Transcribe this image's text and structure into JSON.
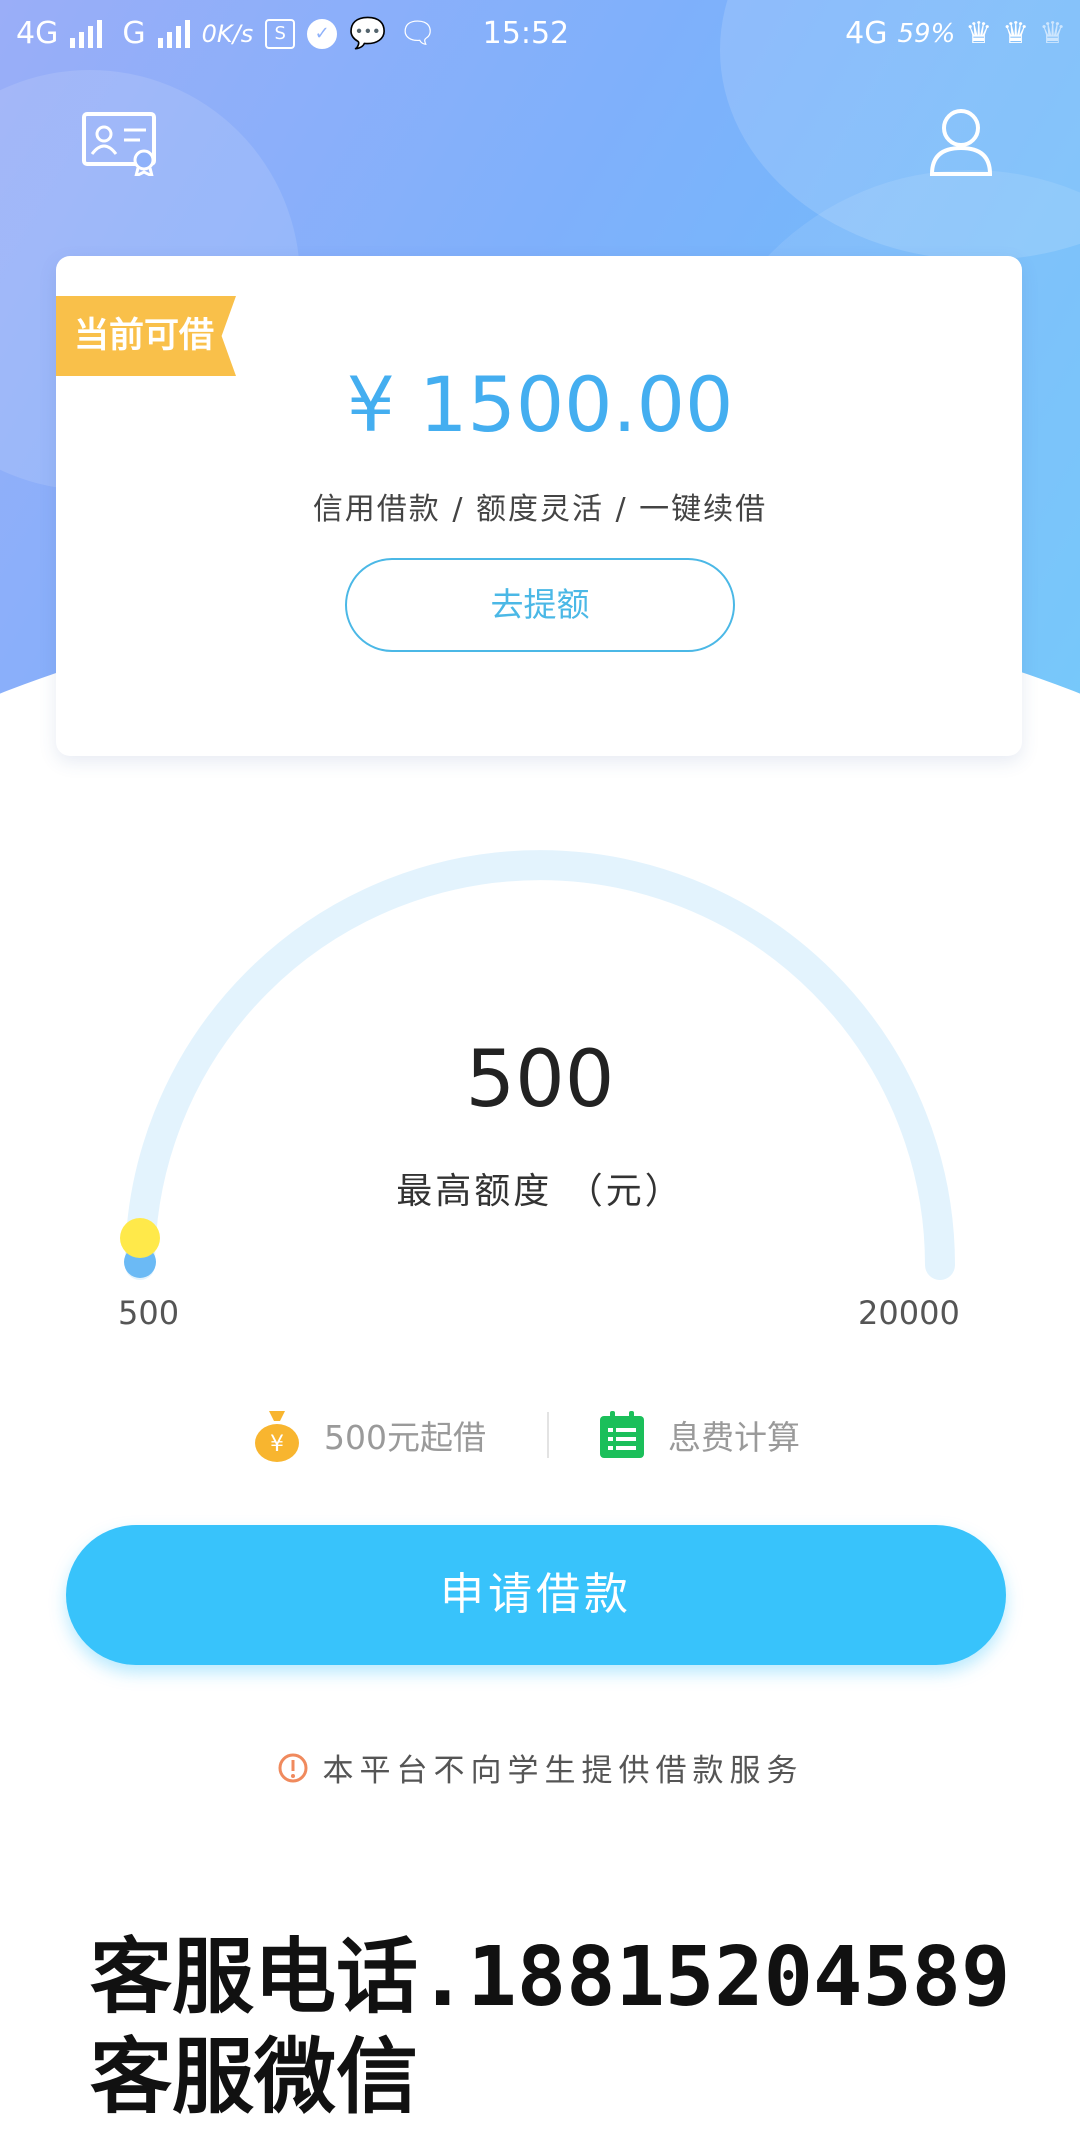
{
  "status_bar": {
    "network_1": "4G",
    "network_2": "G",
    "speed": "0K/s",
    "time": "15:52",
    "right_network": "4G",
    "battery": "59%"
  },
  "card": {
    "badge": "当前可借",
    "amount": "¥ 1500.00",
    "tagline": "信用借款 / 额度灵活 / 一键续借",
    "raise_button": "去提额"
  },
  "gauge": {
    "value": "500",
    "label": "最高额度  （元）",
    "min_label": "500",
    "max_label": "20000",
    "min": 500,
    "max": 20000,
    "current": 500,
    "track_color": "#e3f3fd",
    "knob_color": "#ffe94a",
    "knob_shadow": "#6bbaf5"
  },
  "features": [
    {
      "label": "500元起借",
      "icon": "money-bag-icon"
    },
    {
      "label": "息费计算",
      "icon": "calendar-list-icon"
    }
  ],
  "apply_button": "申请借款",
  "notice": "本平台不向学生提供借款服务",
  "contact": {
    "phone_line": "客服电话.18815204589",
    "wechat_line": "客服微信"
  },
  "colors": {
    "accent": "#38c3fb",
    "amount": "#44aef0",
    "badge": "#f9c04a",
    "notice_icon": "#f08a5d"
  }
}
